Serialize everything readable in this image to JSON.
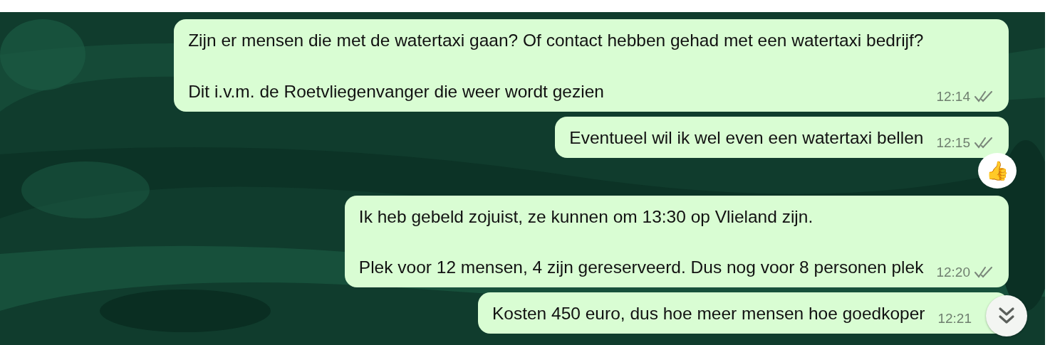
{
  "messages": [
    {
      "paragraphs": [
        "Zijn er mensen die met de watertaxi gaan? Of contact hebben gehad met een watertaxi bedrijf?",
        "Dit i.v.m. de Roetvliegenvanger die weer wordt gezien"
      ],
      "time": "12:14",
      "read": false
    },
    {
      "paragraphs": [
        "Eventueel wil ik wel even een watertaxi bellen"
      ],
      "time": "12:15",
      "read": false,
      "reaction": "👍"
    },
    {
      "paragraphs": [
        "Ik heb gebeld zojuist, ze kunnen om 13:30 op Vlieland zijn.",
        "Plek voor 12 mensen, 4 zijn gereserveerd. Dus nog voor 8 personen plek"
      ],
      "time": "12:20",
      "read": false
    },
    {
      "paragraphs": [
        "Kosten 450 euro, dus hoe meer mensen hoe goedkoper"
      ],
      "time": "12:21"
    }
  ]
}
